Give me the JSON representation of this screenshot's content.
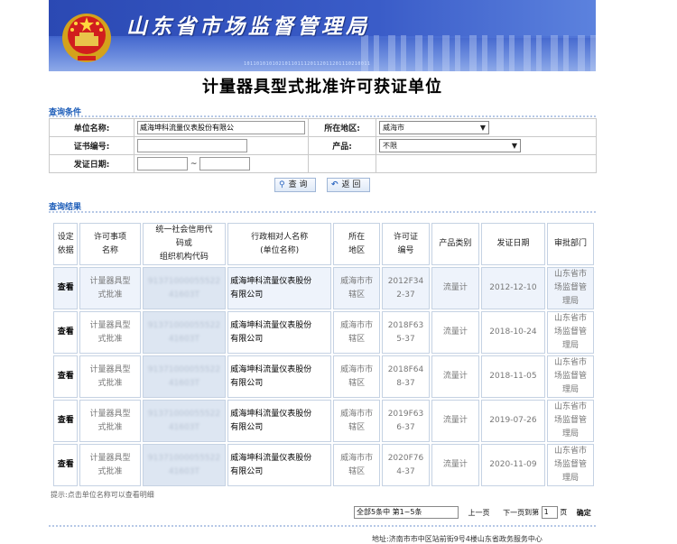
{
  "header": {
    "agency_title": "山东省市场监督管理局",
    "binary_text": "1011010101021011011120112011201110210011",
    "page_title": "计量器具型式批准许可获证单位"
  },
  "query": {
    "section_label": "查询条件",
    "unit_name_label": "单位名称:",
    "unit_name_value": "威海坤科流量仪表股份有限公",
    "region_label": "所在地区:",
    "region_value": "威海市",
    "cert_no_label": "证书编号:",
    "cert_no_value": "",
    "product_label": "产品:",
    "product_value": "不限",
    "issue_date_label": "发证日期:",
    "date_separator": "~",
    "search_button": "查 询",
    "back_button": "返 回"
  },
  "results": {
    "section_label": "查询结果",
    "columns": [
      "设定\n依据",
      "许可事项\n名称",
      "统一社会信用代\n码或\n组织机构代码",
      "行政相对人名称\n(单位名称)",
      "所在\n地区",
      "许可证\n编号",
      "产品类别",
      "发证日期",
      "审批部门"
    ],
    "rows": [
      {
        "action": "查看",
        "item": "计量器具型\n式批准",
        "code": "91371000055522\n41603T",
        "unit": "威海坤科流量仪表股份\n有限公司",
        "region": "威海市市\n辖区",
        "license": "2012F34\n2-37",
        "category": "流量计",
        "date": "2012-12-10",
        "dept": "山东省市\n场监督管\n理局"
      },
      {
        "action": "查看",
        "item": "计量器具型\n式批准",
        "code": "91371000055522\n41603T",
        "unit": "威海坤科流量仪表股份\n有限公司",
        "region": "威海市市\n辖区",
        "license": "2018F63\n5-37",
        "category": "流量计",
        "date": "2018-10-24",
        "dept": "山东省市\n场监督管\n理局"
      },
      {
        "action": "查看",
        "item": "计量器具型\n式批准",
        "code": "91371000055522\n41603T",
        "unit": "威海坤科流量仪表股份\n有限公司",
        "region": "威海市市\n辖区",
        "license": "2018F64\n8-37",
        "category": "流量计",
        "date": "2018-11-05",
        "dept": "山东省市\n场监督管\n理局"
      },
      {
        "action": "查看",
        "item": "计量器具型\n式批准",
        "code": "91371000055522\n41603T",
        "unit": "威海坤科流量仪表股份\n有限公司",
        "region": "威海市市\n辖区",
        "license": "2019F63\n6-37",
        "category": "流量计",
        "date": "2019-07-26",
        "dept": "山东省市\n场监督管\n理局"
      },
      {
        "action": "查看",
        "item": "计量器具型\n式批准",
        "code": "91371000055522\n41603T",
        "unit": "威海坤科流量仪表股份\n有限公司",
        "region": "威海市市\n辖区",
        "license": "2020F76\n4-37",
        "category": "流量计",
        "date": "2020-11-09",
        "dept": "山东省市\n场监督管\n理局"
      }
    ],
    "hint": "提示:点击单位名称可以查看明细"
  },
  "pager": {
    "summary": "全部5条中 第1~5条",
    "prev": "上一页",
    "next": "下一页",
    "goto_prefix": "到第",
    "goto_value": "1",
    "goto_suffix": "页",
    "confirm": "确定"
  },
  "footer": {
    "address": "地址:济南市市中区站前街9号4楼山东省政务服务中心"
  }
}
